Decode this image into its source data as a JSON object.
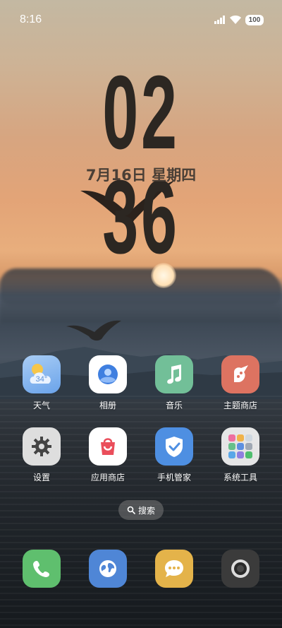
{
  "status_bar": {
    "time": "8:16",
    "battery": "100",
    "icons": [
      "signal-icon",
      "wifi-icon",
      "battery-icon"
    ]
  },
  "lockclock": {
    "time": "02 36",
    "date": "7月16日 星期四"
  },
  "apps": [
    {
      "label": "天气",
      "icon": "weather-icon",
      "badge": "34°",
      "color": "#7fb3ef"
    },
    {
      "label": "相册",
      "icon": "gallery-icon",
      "color": "#ffffff"
    },
    {
      "label": "音乐",
      "icon": "music-icon",
      "color": "#6fbf95"
    },
    {
      "label": "主题商店",
      "icon": "theme-store-icon",
      "color": "#e07a66"
    },
    {
      "label": "设置",
      "icon": "settings-gear-icon",
      "color": "#d9d9d9"
    },
    {
      "label": "应用商店",
      "icon": "app-store-bag-icon",
      "color": "#ffffff"
    },
    {
      "label": "手机管家",
      "icon": "security-shield-icon",
      "color": "#4f8fe0"
    },
    {
      "label": "系统工具",
      "icon": "system-tools-folder-icon",
      "color": "#f2f2f2"
    }
  ],
  "search": {
    "label": "搜索",
    "icon": "search-icon"
  },
  "dock": [
    {
      "icon": "phone-icon",
      "color": "#5fbf6e"
    },
    {
      "icon": "browser-globe-icon",
      "color": "#4f86d6"
    },
    {
      "icon": "messages-icon",
      "color": "#e6b345"
    },
    {
      "icon": "camera-icon",
      "color": "#3a3a3a"
    }
  ]
}
